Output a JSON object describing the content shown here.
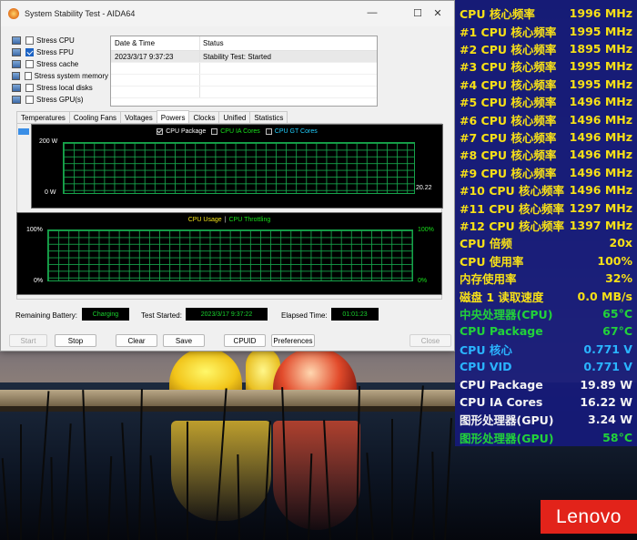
{
  "window": {
    "title": "System Stability Test - AIDA64",
    "controls": {
      "minimize": "—",
      "maximize": "☐",
      "close": "✕"
    }
  },
  "stress_options": [
    {
      "label": "Stress CPU",
      "checked": false,
      "icon": "cpu-icon"
    },
    {
      "label": "Stress FPU",
      "checked": true,
      "icon": "fpu-icon"
    },
    {
      "label": "Stress cache",
      "checked": false,
      "icon": "cache-icon"
    },
    {
      "label": "Stress system memory",
      "checked": false,
      "icon": "memory-icon"
    },
    {
      "label": "Stress local disks",
      "checked": false,
      "icon": "disk-icon"
    },
    {
      "label": "Stress GPU(s)",
      "checked": false,
      "icon": "gpu-icon"
    }
  ],
  "status_table": {
    "headers": [
      "Date & Time",
      "Status"
    ],
    "rows": [
      {
        "datetime": "2023/3/17 9:37:23",
        "status": "Stability Test: Started"
      }
    ]
  },
  "tabs": [
    "Temperatures",
    "Cooling Fans",
    "Voltages",
    "Powers",
    "Clocks",
    "Unified",
    "Statistics"
  ],
  "active_tab": "Powers",
  "graph_power": {
    "legend": [
      "CPU Package",
      "CPU IA Cores",
      "CPU GT Cores"
    ],
    "legend_colors": [
      "#ffffff",
      "#18e01c",
      "#20d0ff"
    ],
    "legend_checked": [
      true,
      false,
      false
    ],
    "y_top": "200 W",
    "y_bottom": "0 W",
    "current_value": "20.22"
  },
  "graph_usage": {
    "legend_a": "CPU Usage",
    "separator": "|",
    "legend_b": "CPU Throttling",
    "color_a": "#f2e21a",
    "color_b": "#18e01c",
    "y_left_top": "100%",
    "y_left_bottom": "0%",
    "y_right_top": "100%",
    "y_right_bottom": "0%"
  },
  "status_bar": {
    "battery_label": "Remaining Battery:",
    "battery_value": "Charging",
    "started_label": "Test Started:",
    "started_value": "2023/3/17 9:37:22",
    "elapsed_label": "Elapsed Time:",
    "elapsed_value": "01:01:23"
  },
  "buttons": {
    "start": "Start",
    "stop": "Stop",
    "clear": "Clear",
    "save": "Save",
    "cpuid": "CPUID",
    "preferences": "Preferences",
    "close": "Close"
  },
  "osd": {
    "rows": [
      {
        "label": "CPU 核心频率",
        "value": "1996 MHz",
        "color": "#f7e017"
      },
      {
        "label": "#1 CPU 核心频率",
        "value": "1995 MHz",
        "color": "#f7e017"
      },
      {
        "label": "#2 CPU 核心频率",
        "value": "1895 MHz",
        "color": "#f7e017"
      },
      {
        "label": "#3 CPU 核心频率",
        "value": "1995 MHz",
        "color": "#f7e017"
      },
      {
        "label": "#4 CPU 核心频率",
        "value": "1995 MHz",
        "color": "#f7e017"
      },
      {
        "label": "#5 CPU 核心频率",
        "value": "1496 MHz",
        "color": "#f7e017"
      },
      {
        "label": "#6 CPU 核心频率",
        "value": "1496 MHz",
        "color": "#f7e017"
      },
      {
        "label": "#7 CPU 核心频率",
        "value": "1496 MHz",
        "color": "#f7e017"
      },
      {
        "label": "#8 CPU 核心频率",
        "value": "1496 MHz",
        "color": "#f7e017"
      },
      {
        "label": "#9 CPU 核心频率",
        "value": "1496 MHz",
        "color": "#f7e017"
      },
      {
        "label": "#10 CPU 核心频率",
        "value": "1496 MHz",
        "color": "#f7e017"
      },
      {
        "label": "#11 CPU 核心频率",
        "value": "1297 MHz",
        "color": "#f7e017"
      },
      {
        "label": "#12 CPU 核心频率",
        "value": "1397 MHz",
        "color": "#f7e017"
      },
      {
        "label": "CPU 倍频",
        "value": "20x",
        "color": "#f7e017"
      },
      {
        "label": "CPU 使用率",
        "value": "100%",
        "color": "#f7e017"
      },
      {
        "label": "内存使用率",
        "value": "32%",
        "color": "#f7e017"
      },
      {
        "label": "磁盘 1 读取速度",
        "value": "0.0 MB/s",
        "color": "#f7e017"
      },
      {
        "label": "中央处理器(CPU)",
        "value": "65°C",
        "color": "#22d23a"
      },
      {
        "label": "CPU Package",
        "value": "67°C",
        "color": "#22d23a"
      },
      {
        "label": "CPU 核心",
        "value": "0.771 V",
        "color": "#2ab4ff"
      },
      {
        "label": "CPU VID",
        "value": "0.771 V",
        "color": "#2ab4ff"
      },
      {
        "label": "CPU Package",
        "value": "19.89 W",
        "color": "#f4f4f4"
      },
      {
        "label": "CPU IA Cores",
        "value": "16.22 W",
        "color": "#f4f4f4"
      },
      {
        "label": "图形处理器(GPU)",
        "value": "3.24 W",
        "color": "#f4f4f4"
      },
      {
        "label": "图形处理器(GPU)",
        "value": "58°C",
        "color": "#22d23a"
      }
    ]
  },
  "brand": {
    "logo_text": "Lenovo",
    "color": "#e2231a"
  }
}
